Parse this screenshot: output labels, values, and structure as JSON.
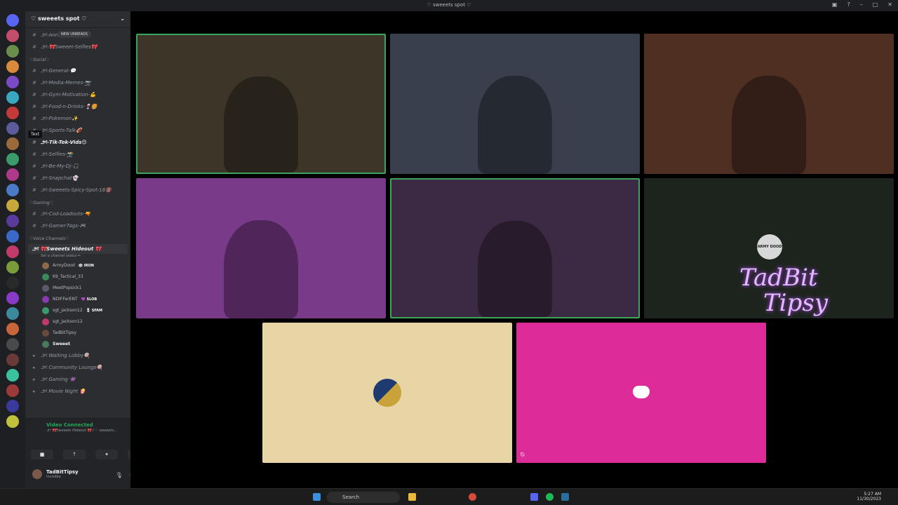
{
  "window": {
    "title": "♡ sweeets spot ♡"
  },
  "server": {
    "name": "♡ sweeets spot ♡",
    "new_unreads": "NEW UNREADS"
  },
  "channels": [
    {
      "type": "text",
      "label": "౨ৎ-Anno...",
      "bold": false
    },
    {
      "type": "text",
      "label": "౨ৎ-🎀Sweeet-Selfies🎀",
      "bold": false
    },
    {
      "type": "category",
      "label": "♡Social♡"
    },
    {
      "type": "text",
      "label": "౨ৎ-General-💬",
      "bold": false
    },
    {
      "type": "text",
      "label": "౨ৎ-Media-Memes-📷",
      "bold": false
    },
    {
      "type": "text",
      "label": "౨ৎ-Gym-Motivation-💪",
      "bold": false
    },
    {
      "type": "text",
      "label": "౨ৎ-Food-n-Drinks-🍷🍔",
      "bold": false
    },
    {
      "type": "text",
      "label": "౨ৎ-Pokemon✨",
      "bold": false
    },
    {
      "type": "text",
      "label": "౨ৎ-Sports-Talk🏈",
      "bold": false
    },
    {
      "type": "text",
      "label": "౨ৎ-Tik-Tok-Vids😊",
      "bold": true
    },
    {
      "type": "text",
      "label": "౨ৎ-Selfies-📸",
      "bold": false
    },
    {
      "type": "text",
      "label": "౨ৎ-Be-My-Dj-🎧",
      "bold": false
    },
    {
      "type": "text",
      "label": "౨ৎ-Snapchat👻",
      "bold": false
    },
    {
      "type": "text",
      "label": "౨ৎ-Sweeets-Spicy-Spot-18🔞",
      "bold": false
    },
    {
      "type": "category",
      "label": "♡Gaming♡"
    },
    {
      "type": "text",
      "label": "౨ৎ-Cod-Loadouts-🔫",
      "bold": false
    },
    {
      "type": "text",
      "label": "౨ৎ-Gamer-Tags-🎮",
      "bold": false
    },
    {
      "type": "category",
      "label": "♡Voice Channels♡"
    }
  ],
  "active_voice": {
    "label": "౨ৎ 🎀Sweeets Hideout 🎀",
    "status": "Set a channel status ✏",
    "members": [
      {
        "name": "ArmyDood",
        "badge": "👁 IRON"
      },
      {
        "name": "K9_Tactical_33",
        "badge": ""
      },
      {
        "name": "MeetPopsick1",
        "badge": ""
      },
      {
        "name": "NDIFFerENT",
        "badge": "💜 SLOB"
      },
      {
        "name": "sgt_jackson12",
        "badge": "🎖 SFAM"
      },
      {
        "name": "sgt_jackson12",
        "badge": ""
      },
      {
        "name": "TadBitTipsy",
        "badge": ""
      },
      {
        "name": "Sweeet",
        "badge": ""
      }
    ]
  },
  "voice_channels": [
    {
      "label": "౨ৎ Waiting Lobby🍭"
    },
    {
      "label": "౨ৎ Community Lounge🍭"
    },
    {
      "label": "౨ৎ Gaming 👾"
    },
    {
      "label": "౨ৎ Movie Night 🍿"
    }
  ],
  "panel": {
    "connected": "Video Connected",
    "channel": "౨ৎ 🎀Sweeets Hideout 🎀 / ♡ sweeets...",
    "username": "TadBitTipsy",
    "user_status": "Invisible"
  },
  "tooltip": "Text",
  "tiles": [
    {
      "kind": "video",
      "color": "#3d3528",
      "border": "#3ba55d"
    },
    {
      "kind": "video",
      "color": "#3a3f4e",
      "border": "none"
    },
    {
      "kind": "video",
      "color": "#4e2f22",
      "border": "none"
    },
    {
      "kind": "video",
      "color": "#7a3a8a",
      "border": "none"
    },
    {
      "kind": "video",
      "color": "#3c2a44",
      "border": "#3ba55d"
    },
    {
      "kind": "logo",
      "color": "#1d241d",
      "logo_line1": "TadBit",
      "logo_line2": "Tipsy",
      "badge": "ARMY DOOD"
    },
    {
      "kind": "avatar",
      "color": "#e8d5a6"
    },
    {
      "kind": "discord",
      "color": "#dd2c9a"
    }
  ],
  "taskbar": {
    "search_placeholder": "Search",
    "time": "5:27 AM",
    "date": "11/30/2023"
  }
}
